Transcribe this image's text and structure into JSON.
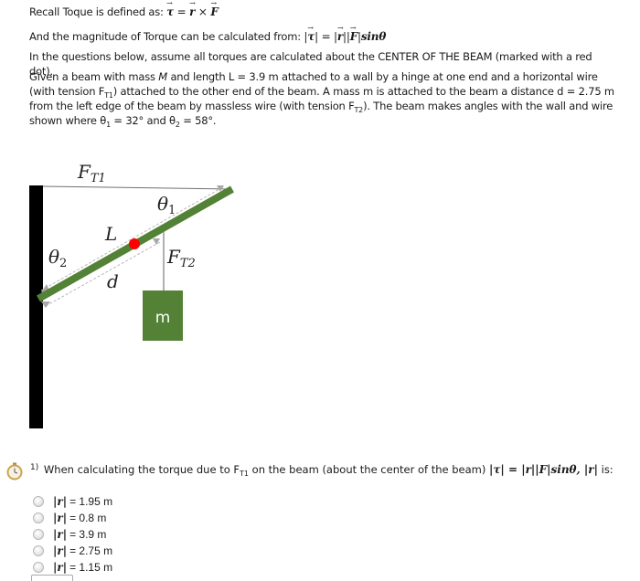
{
  "intro": {
    "line1_text": "Recall Toque is defined as: ",
    "line1_formula": {
      "lhs": "τ",
      "eq": " = ",
      "r": "r",
      "times": " × ",
      "F": "F"
    },
    "line2_text": "And the magnitude of Torque can be calculated from: ",
    "line2_formula": {
      "tau": "τ",
      "r": "r",
      "F": "F",
      "sin": "sinθ"
    },
    "line3_text": "In the questions below, assume all torques are calculated about the CENTER OF THE BEAM (marked with a red dot).",
    "problem": {
      "part1": "Given a beam with mass ",
      "mass_symbol": "M",
      "part2": " and length L = 3.9 m attached to a wall by a hinge at one end and a horizontal wire (with tension F",
      "sub_t1": "T1",
      "part3": ") attached to the other end of the beam. A mass m is attached to the beam a distance d = 2.75 m from the left edge of the beam by massless wire (with tension F",
      "sub_t2": "T2",
      "part4": "). The beam makes angles with the wall and wire shown where θ",
      "sub_1": "1",
      "part5": " = 32° and θ",
      "sub_2": "2",
      "part6": " = 58°."
    }
  },
  "diagram": {
    "label_ft1": "F",
    "label_ft1_sub": "T1",
    "label_ft2": "F",
    "label_ft2_sub": "T2",
    "label_theta1": "θ",
    "label_theta1_sub": "1",
    "label_theta2": "θ",
    "label_theta2_sub": "2",
    "label_L": "L",
    "label_d": "d",
    "label_mass": "m",
    "colors": {
      "wall": "#000000",
      "beam": "#538135",
      "mass": "#538135",
      "center_dot": "#ff0000",
      "wire": "#b0b0b0",
      "dim_line": "#b8b8b8"
    }
  },
  "question": {
    "number": "1)",
    "text_before": " When calculating the torque due to F",
    "sub": "T1",
    "text_after": " on the beam (about the center of the beam) ",
    "formula": "|τ| = |r||F|sinθ, ",
    "tail_formula": "|r|",
    "tail_text": " is:",
    "icon": "stopwatch-icon"
  },
  "options": [
    {
      "label": "|r|",
      "value": "= 1.95 m"
    },
    {
      "label": "|r|",
      "value": "= 0.8 m"
    },
    {
      "label": "|r|",
      "value": "= 3.9 m"
    },
    {
      "label": "|r|",
      "value": "= 2.75 m"
    },
    {
      "label": "|r|",
      "value": "= 1.15 m"
    }
  ]
}
